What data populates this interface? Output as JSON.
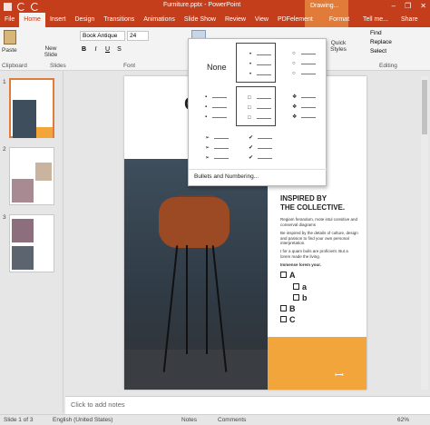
{
  "window": {
    "doc_title": "Furniture.pptx - PowerPoint",
    "context_tab": "Drawing...",
    "controls": [
      "–",
      "❐",
      "✕"
    ]
  },
  "tabs": [
    "File",
    "Home",
    "Insert",
    "Design",
    "Transitions",
    "Animations",
    "Slide Show",
    "Review",
    "View",
    "PDFelement",
    "Format"
  ],
  "active_tab": "Home",
  "tellme": "Tell me...",
  "share": "Share",
  "ribbon": {
    "paste": "Paste",
    "new_slide": "New Slide",
    "font_name": "Book Antique",
    "font_size": "24",
    "quick_styles": "Quick Styles",
    "find": "Find",
    "replace": "Replace",
    "select": "Select",
    "groups": [
      "Clipboard",
      "Slides",
      "Font",
      "Editing"
    ]
  },
  "dropdown": {
    "none": "None",
    "bullets_numbering": "Bullets and Numbering..."
  },
  "thumbs": [
    "1",
    "2",
    "3"
  ],
  "slide": {
    "big_letter": "C",
    "heading_line1": "INSPIRED BY",
    "heading_line2": "THE COLLECTIVE.",
    "para1": "Regiam ferandum, mote istul consitive and conserval diagrams",
    "para2": "Be inspired by the details of culture, design and passion to find your own personal interpretation.",
    "para3": "I for a quam boils are proficient. But a lorem made the living.",
    "bold_line": "Immense lorem your.",
    "checklist": [
      "A",
      "a",
      "b",
      "B",
      "C"
    ],
    "logo": "ꟷ"
  },
  "notes_placeholder": "Click to add notes",
  "status": {
    "slide": "Slide 1 of 3",
    "language": "English (United States)",
    "notes": "Notes",
    "comments": "Comments",
    "zoom": "62%"
  }
}
